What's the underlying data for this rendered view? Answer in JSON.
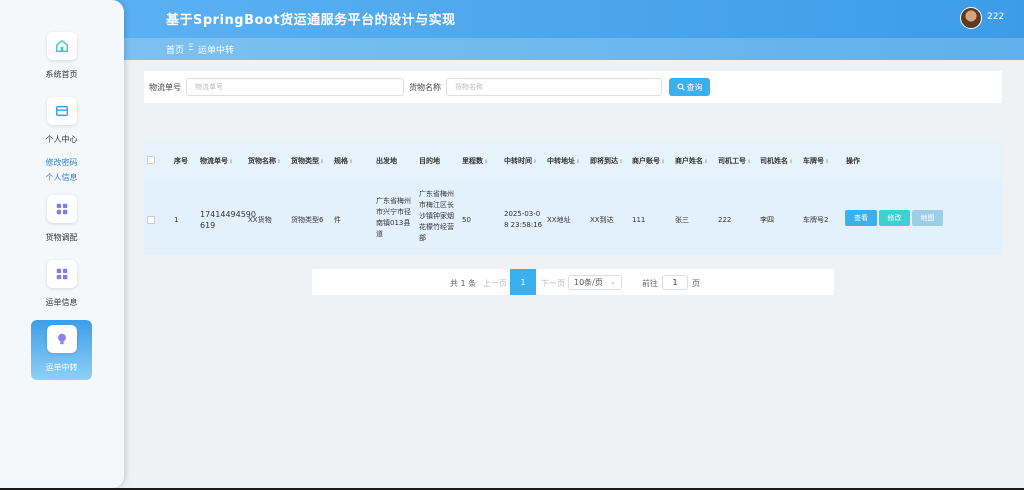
{
  "app": {
    "title": "基于SpringBoot货运通服务平台的设计与实现",
    "username": "222"
  },
  "breadcrumb": {
    "home": "首页",
    "separator": "Ξ",
    "current": "运单中转"
  },
  "sidebar": {
    "items": [
      {
        "label": "系统首页",
        "icon": "home-icon"
      },
      {
        "label": "个人中心",
        "icon": "card-icon",
        "subitems": [
          "修改密码",
          "个人信息"
        ]
      },
      {
        "label": "货物调配",
        "icon": "grid-icon"
      },
      {
        "label": "运单信息",
        "icon": "grid-icon"
      },
      {
        "label": "运单中转",
        "icon": "bulb-icon",
        "active": true
      }
    ]
  },
  "search": {
    "field1_label": "物流单号",
    "field1_placeholder": "物流单号",
    "field2_label": "货物名称",
    "field2_placeholder": "货物名称",
    "query_button": "查询"
  },
  "table": {
    "headers": [
      "序号",
      "物流单号",
      "货物名称",
      "货物类型",
      "规格",
      "出发地",
      "目的地",
      "里程数",
      "中转时间",
      "中转地址",
      "即将到达",
      "商户账号",
      "商户姓名",
      "司机工号",
      "司机姓名",
      "车牌号",
      "操作"
    ],
    "rows": [
      {
        "index": "1",
        "tracking_no_1": "17414494590",
        "tracking_no_2": "619",
        "goods_name": "XX货物",
        "goods_type": "货物类型6",
        "spec": "件",
        "origin": [
          "广东省梅州",
          "市兴宁市径",
          "南镇013县",
          "道"
        ],
        "destination": [
          "广东省梅州",
          "市梅江区长",
          "沙镇钟家烟",
          "花檬竹经营",
          "部"
        ],
        "mileage": "50",
        "transfer_time_1": "2025-03-0",
        "transfer_time_2": "8 23:58:16",
        "transfer_addr": "XX地址",
        "arriving": "XX到达",
        "merchant_account": "111",
        "merchant_name": "张三",
        "driver_id": "222",
        "driver_name": "李四",
        "plate_no": "车牌号2",
        "actions": [
          "查看",
          "修改",
          "地图"
        ]
      }
    ]
  },
  "pagination": {
    "total": "共 1 条",
    "prev": "上一页",
    "current_page": "1",
    "next": "下一页",
    "page_size": "10条/页",
    "goto_prefix": "前往",
    "goto_value": "1",
    "goto_suffix": "页"
  },
  "colors": {
    "primary": "#3ab0ef",
    "success": "#3fd1d1",
    "disabled": "#9ccfe6",
    "sidebar_active": "#3d9ee9"
  }
}
